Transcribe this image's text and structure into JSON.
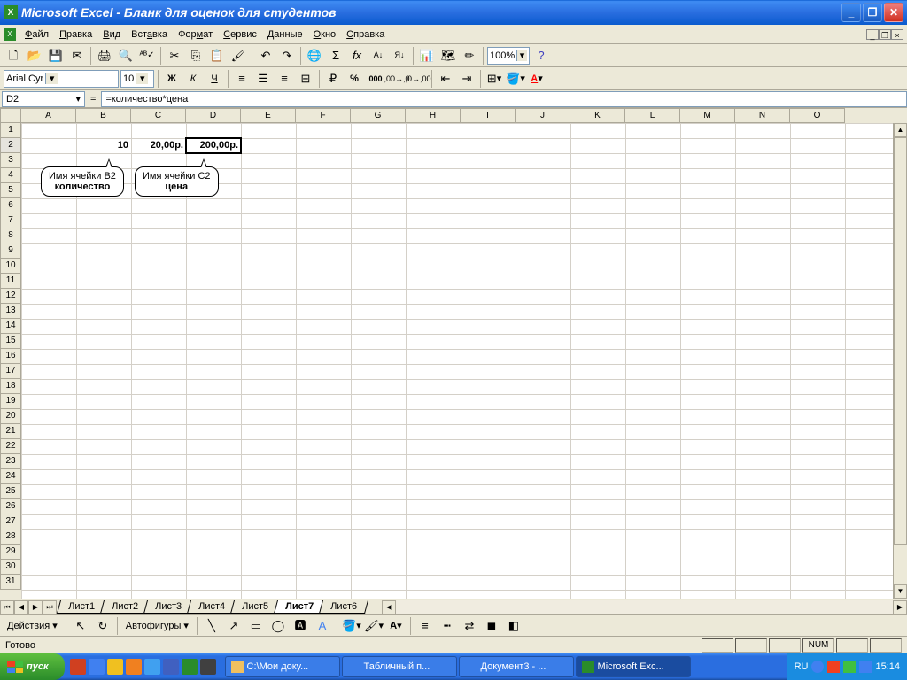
{
  "title": "Microsoft Excel - Бланк для оценок для студентов",
  "menu": [
    "Файл",
    "Правка",
    "Вид",
    "Вставка",
    "Формат",
    "Сервис",
    "Данные",
    "Окно",
    "Справка"
  ],
  "font_name": "Arial Cyr",
  "font_size": "10",
  "zoom": "100%",
  "name_box": "D2",
  "formula": "=количество*цена",
  "columns": [
    "A",
    "B",
    "C",
    "D",
    "E",
    "F",
    "G",
    "H",
    "I",
    "J",
    "K",
    "L",
    "M",
    "N",
    "O"
  ],
  "row_count": 31,
  "cells": {
    "B2": "10",
    "C2": "20,00р.",
    "D2": "200,00р."
  },
  "callout1": {
    "line1": "Имя ячейки В2",
    "line2": "количество"
  },
  "callout2": {
    "line1": "Имя ячейки С2",
    "line2": "цена"
  },
  "sheets": [
    "Лист1",
    "Лист2",
    "Лист3",
    "Лист4",
    "Лист5",
    "Лист7",
    "Лист6"
  ],
  "active_sheet": "Лист7",
  "draw_actions": "Действия",
  "draw_autoshapes": "Автофигуры",
  "status_ready": "Готово",
  "status_num": "NUM",
  "start_label": "пуск",
  "task_buttons": [
    {
      "label": "С:\\Мои доку...",
      "icon": "#f0c060"
    },
    {
      "label": "Табличный п...",
      "icon": "#3a7de8"
    },
    {
      "label": "Документ3 - ...",
      "icon": "#3a7de8"
    },
    {
      "label": "Microsoft Exc...",
      "icon": "#2a8c2a",
      "active": true
    }
  ],
  "tray_lang": "RU",
  "tray_time": "15:14"
}
